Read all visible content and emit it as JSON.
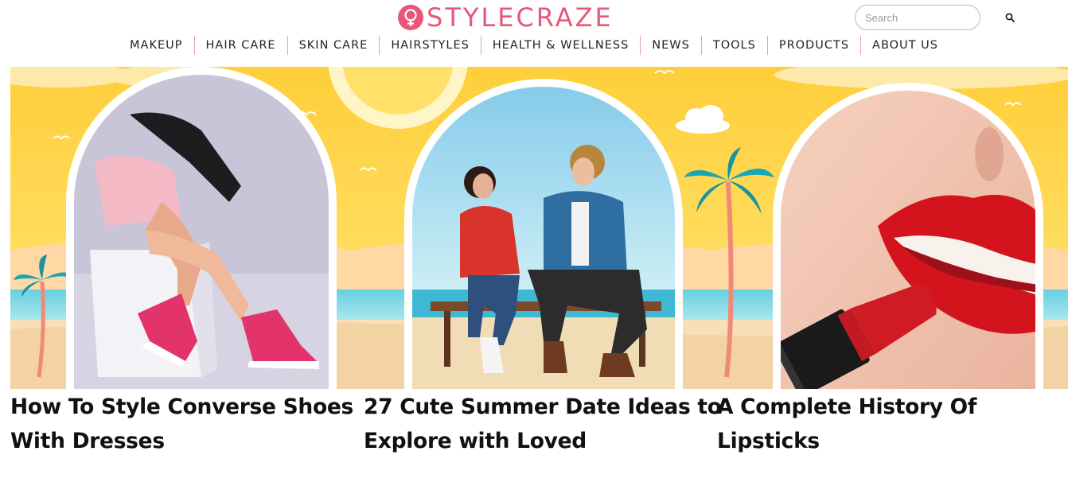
{
  "brand": {
    "name": "STYLECRAZE",
    "accent": "#e8577a",
    "logo_icon": "female-symbol-icon"
  },
  "search": {
    "placeholder": "Search",
    "icon": "search-icon"
  },
  "nav": {
    "items": [
      {
        "label": "MAKEUP"
      },
      {
        "label": "HAIR CARE"
      },
      {
        "label": "SKIN CARE"
      },
      {
        "label": "HAIRSTYLES"
      },
      {
        "label": "HEALTH & WELLNESS"
      },
      {
        "label": "NEWS"
      },
      {
        "label": "TOOLS"
      },
      {
        "label": "PRODUCTS"
      },
      {
        "label": "ABOUT US"
      }
    ]
  },
  "hero": {
    "scene": "summer beach banner",
    "images": [
      {
        "subject": "woman in pink skirt and pink converse sneakers"
      },
      {
        "subject": "couple on a bench at the beach"
      },
      {
        "subject": "red lipstick on lips"
      }
    ]
  },
  "articles": [
    {
      "title": "How To Style Converse Shoes With Dresses"
    },
    {
      "title": "27 Cute Summer Date Ideas to Explore with Loved"
    },
    {
      "title": "A Complete History Of Lipsticks"
    }
  ]
}
